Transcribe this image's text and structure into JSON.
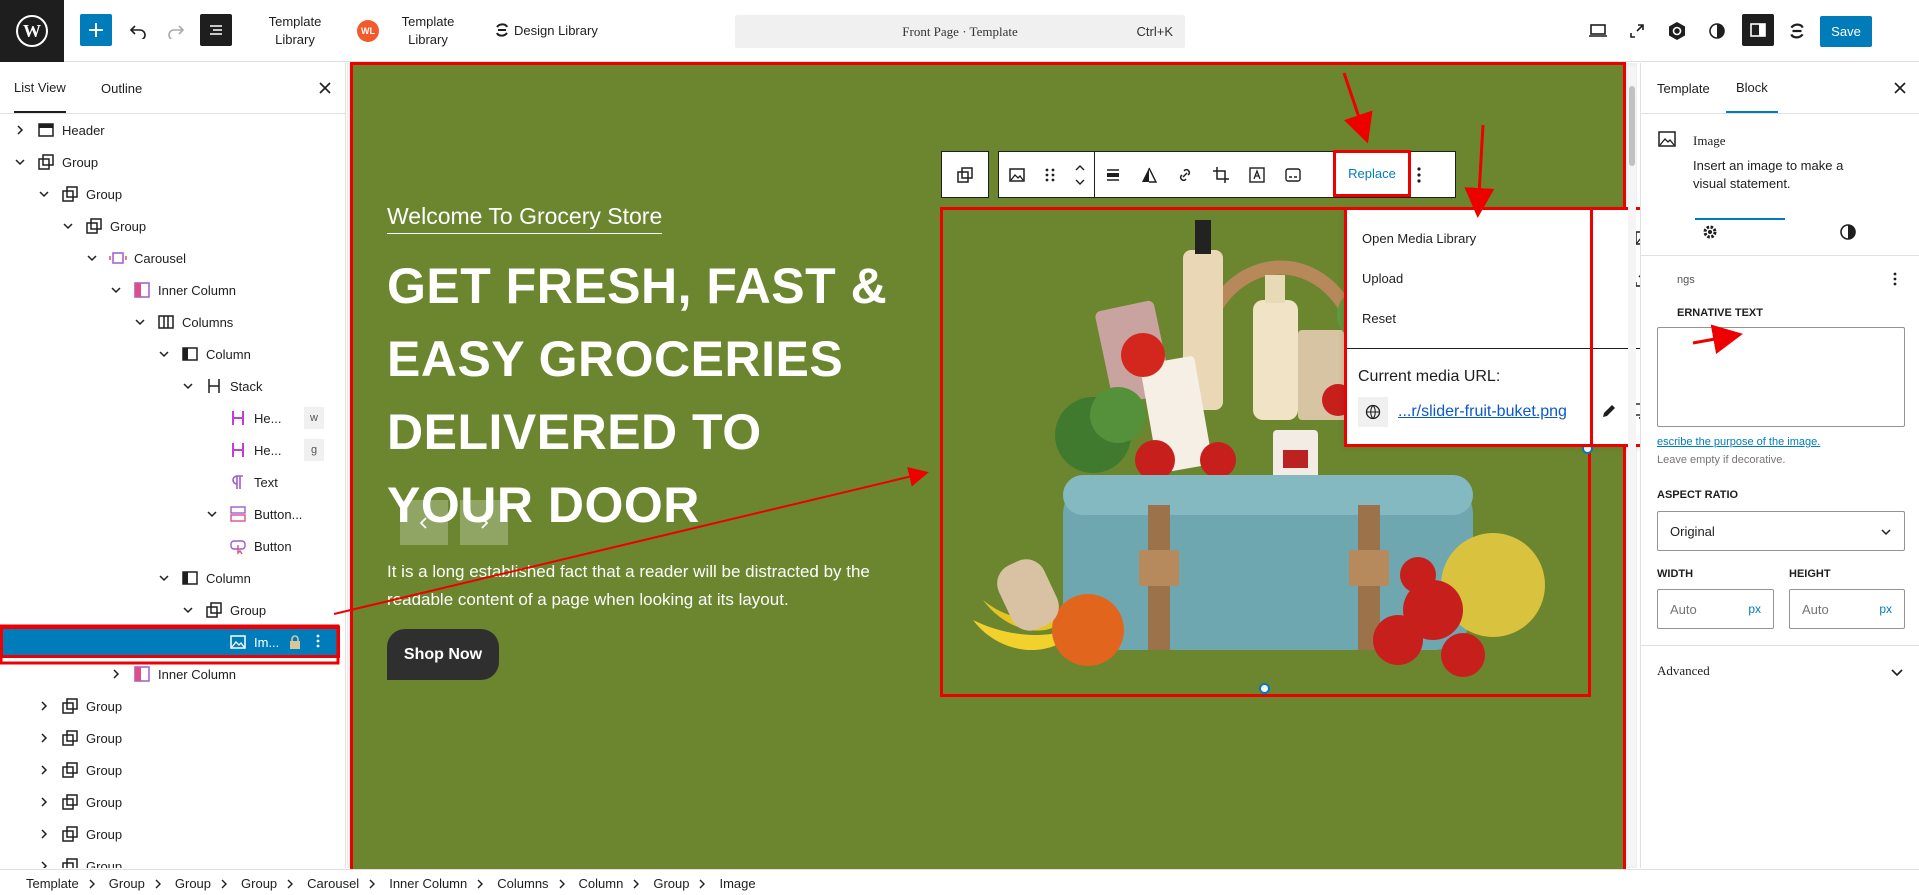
{
  "topbar": {
    "plugin1_label_line1": "Template",
    "plugin1_label_line2": "Library",
    "plugin2_label_line1": "Template",
    "plugin2_label_line2": "Library",
    "plugin2_badge": "WL",
    "design_library": "Design Library",
    "command_title": "Front Page · Template",
    "command_shortcut": "Ctrl+K",
    "save": "Save"
  },
  "left_panel": {
    "tabs": [
      "List View",
      "Outline"
    ],
    "rows": [
      {
        "label": "Header"
      },
      {
        "label": "Group"
      },
      {
        "label": "Group"
      },
      {
        "label": "Group"
      },
      {
        "label": "Carousel"
      },
      {
        "label": "Inner Column"
      },
      {
        "label": "Columns"
      },
      {
        "label": "Column"
      },
      {
        "label": "Stack"
      },
      {
        "label": "He...",
        "badge": "w"
      },
      {
        "label": "He...",
        "badge": "g"
      },
      {
        "label": "Text"
      },
      {
        "label": "Button..."
      },
      {
        "label": "Button"
      },
      {
        "label": "Column"
      },
      {
        "label": "Group"
      },
      {
        "label": "Im..."
      },
      {
        "label": "Inner Column"
      },
      {
        "label": "Group"
      },
      {
        "label": "Group"
      },
      {
        "label": "Group"
      },
      {
        "label": "Group"
      },
      {
        "label": "Group"
      },
      {
        "label": "Group"
      }
    ]
  },
  "canvas": {
    "subtitle": "Welcome To Grocery Store",
    "title": "GET FRESH, FAST & EASY GROCERIES DELIVERED TO YOUR DOOR",
    "body": "It is a long established fact that a reader will be distracted by the readable content of a page when looking at its layout.",
    "cta": "Shop Now"
  },
  "block_toolbar": {
    "replace": "Replace"
  },
  "replace_menu": {
    "items": [
      "Open Media Library",
      "Upload",
      "Reset"
    ],
    "current_url_label": "Current media URL:",
    "current_url": "...r/slider-fruit-buket.png"
  },
  "right_panel": {
    "tabs": [
      "Template",
      "Block"
    ],
    "block_name": "Image",
    "block_desc": "Insert an image to make a visual statement.",
    "settings_label": "ngs",
    "alt_label": "ERNATIVE TEXT",
    "alt_help_link": "escribe the purpose of the image.",
    "alt_help_note": "Leave empty if decorative.",
    "aspect_label": "ASPECT RATIO",
    "aspect_value": "Original",
    "width_label": "WIDTH",
    "height_label": "HEIGHT",
    "width_placeholder": "Auto",
    "height_placeholder": "Auto",
    "unit": "px",
    "advanced": "Advanced"
  },
  "breadcrumb": [
    "Template",
    "Group",
    "Group",
    "Group",
    "Carousel",
    "Inner Column",
    "Columns",
    "Column",
    "Group",
    "Image"
  ],
  "colors": {
    "canvas_bg": "#6b862f",
    "accent": "#007cba",
    "annotation": "#e00000"
  }
}
